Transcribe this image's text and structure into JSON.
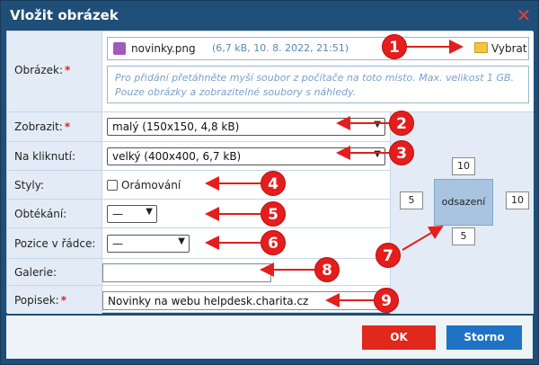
{
  "dialog": {
    "title": "Vložit obrázek",
    "close_icon": "close-x-icon"
  },
  "fields": {
    "image": {
      "label": "Obrázek:",
      "required": "*",
      "file_name": "novinky.png",
      "file_meta": "(6,7 kB, 10. 8. 2022, 21:51)",
      "pick_label": "Vybrat",
      "drop_text": "Pro přidání přetáhněte myší soubor z počítače na toto místo. Max. velikost 1 GB. Pouze obrázky a zobrazitelné soubory s náhledy."
    },
    "display": {
      "label": "Zobrazit:",
      "required": "*",
      "value": "malý (150x150, 4,8 kB)"
    },
    "on_click": {
      "label": "Na kliknutí:",
      "value": "velký (400x400, 6,7 kB)"
    },
    "styles": {
      "label": "Styly:",
      "checkbox_label": "Orámování",
      "checked": false
    },
    "wrap": {
      "label": "Obtékání:",
      "value": "—"
    },
    "inline_position": {
      "label": "Pozice v řádce:",
      "value": "—"
    },
    "gallery": {
      "label": "Galerie:",
      "value": ""
    },
    "caption": {
      "label": "Popisek:",
      "required": "*",
      "value": "Novinky na webu helpdesk.charita.cz"
    }
  },
  "padding": {
    "center_label": "odsazení",
    "top": "10",
    "left": "5",
    "right": "10",
    "bottom": "5"
  },
  "buttons": {
    "ok": "OK",
    "cancel": "Storno"
  },
  "markers": [
    "1",
    "2",
    "3",
    "4",
    "5",
    "6",
    "7",
    "8",
    "9"
  ],
  "colors": {
    "title_bar": "#1f4e79",
    "label_bg": "#e3ecf6",
    "ok": "#e0281c",
    "cancel": "#1f72c4",
    "marker": "#e41d1d",
    "required": "#dd2222"
  }
}
